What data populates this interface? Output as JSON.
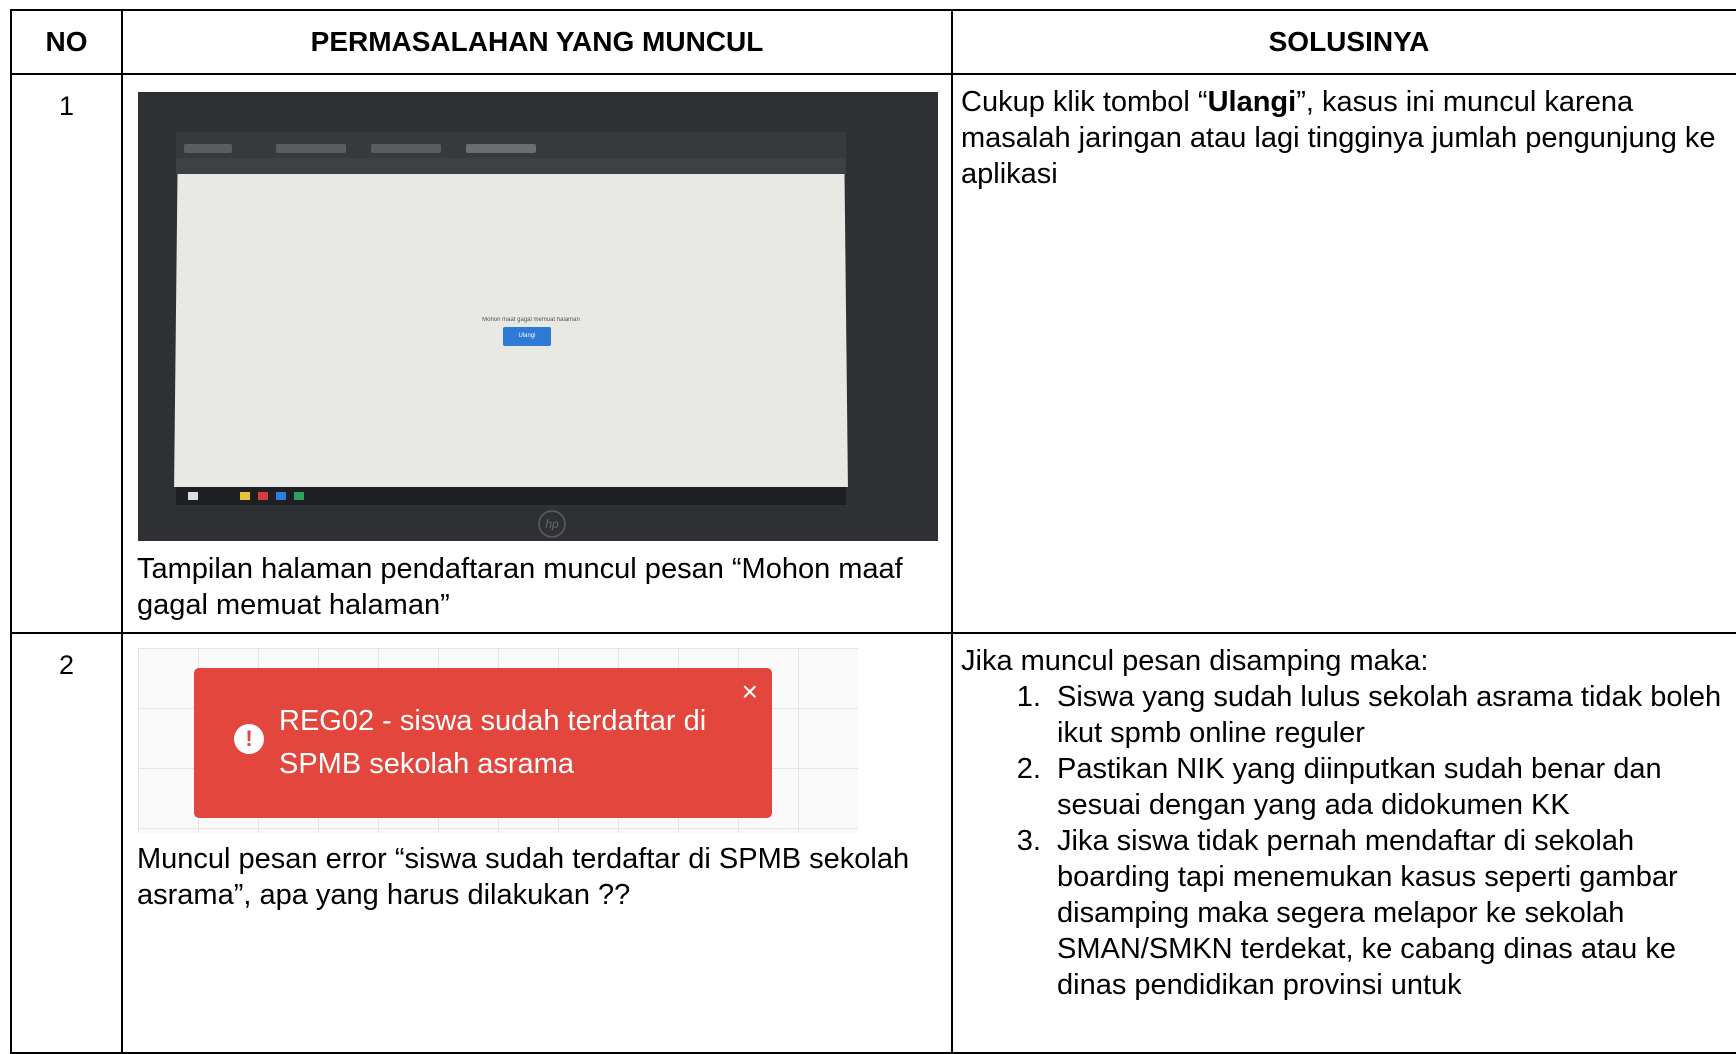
{
  "headers": {
    "no": "NO",
    "problem": "PERMASALAHAN YANG MUNCUL",
    "solution": "SOLUSINYA"
  },
  "row1": {
    "no": "1",
    "photo": {
      "page_message": "Mohon maaf gagal memuat halaman",
      "retry_button": "Ulangi",
      "logo": "hp"
    },
    "caption": "Tampilan halaman pendaftaran muncul pesan “Mohon maaf gagal memuat halaman”",
    "solution_pre": "Cukup klik tombol “",
    "solution_bold": "Ulangi",
    "solution_post": "”, kasus ini muncul karena masalah jaringan atau lagi tingginya jumlah pengunjung ke aplikasi"
  },
  "row2": {
    "no": "2",
    "error_toast": {
      "icon": "exclamation-circle-icon",
      "message": "REG02 - siswa sudah terdaftar di SPMB sekolah asrama",
      "close": "×"
    },
    "caption": "Muncul pesan error “siswa sudah terdaftar di SPMB sekolah asrama”, apa yang harus dilakukan ??",
    "solution_intro": "Jika muncul pesan disamping maka:",
    "solution_items": [
      "Siswa yang sudah lulus sekolah asrama tidak boleh ikut spmb online reguler",
      "Pastikan NIK yang diinputkan sudah benar dan sesuai dengan yang ada didokumen KK",
      "Jika siswa tidak pernah mendaftar di sekolah boarding tapi menemukan kasus seperti gambar disamping maka segera melapor ke sekolah SMAN/SMKN terdekat, ke cabang dinas atau ke dinas pendidikan provinsi untuk"
    ]
  }
}
